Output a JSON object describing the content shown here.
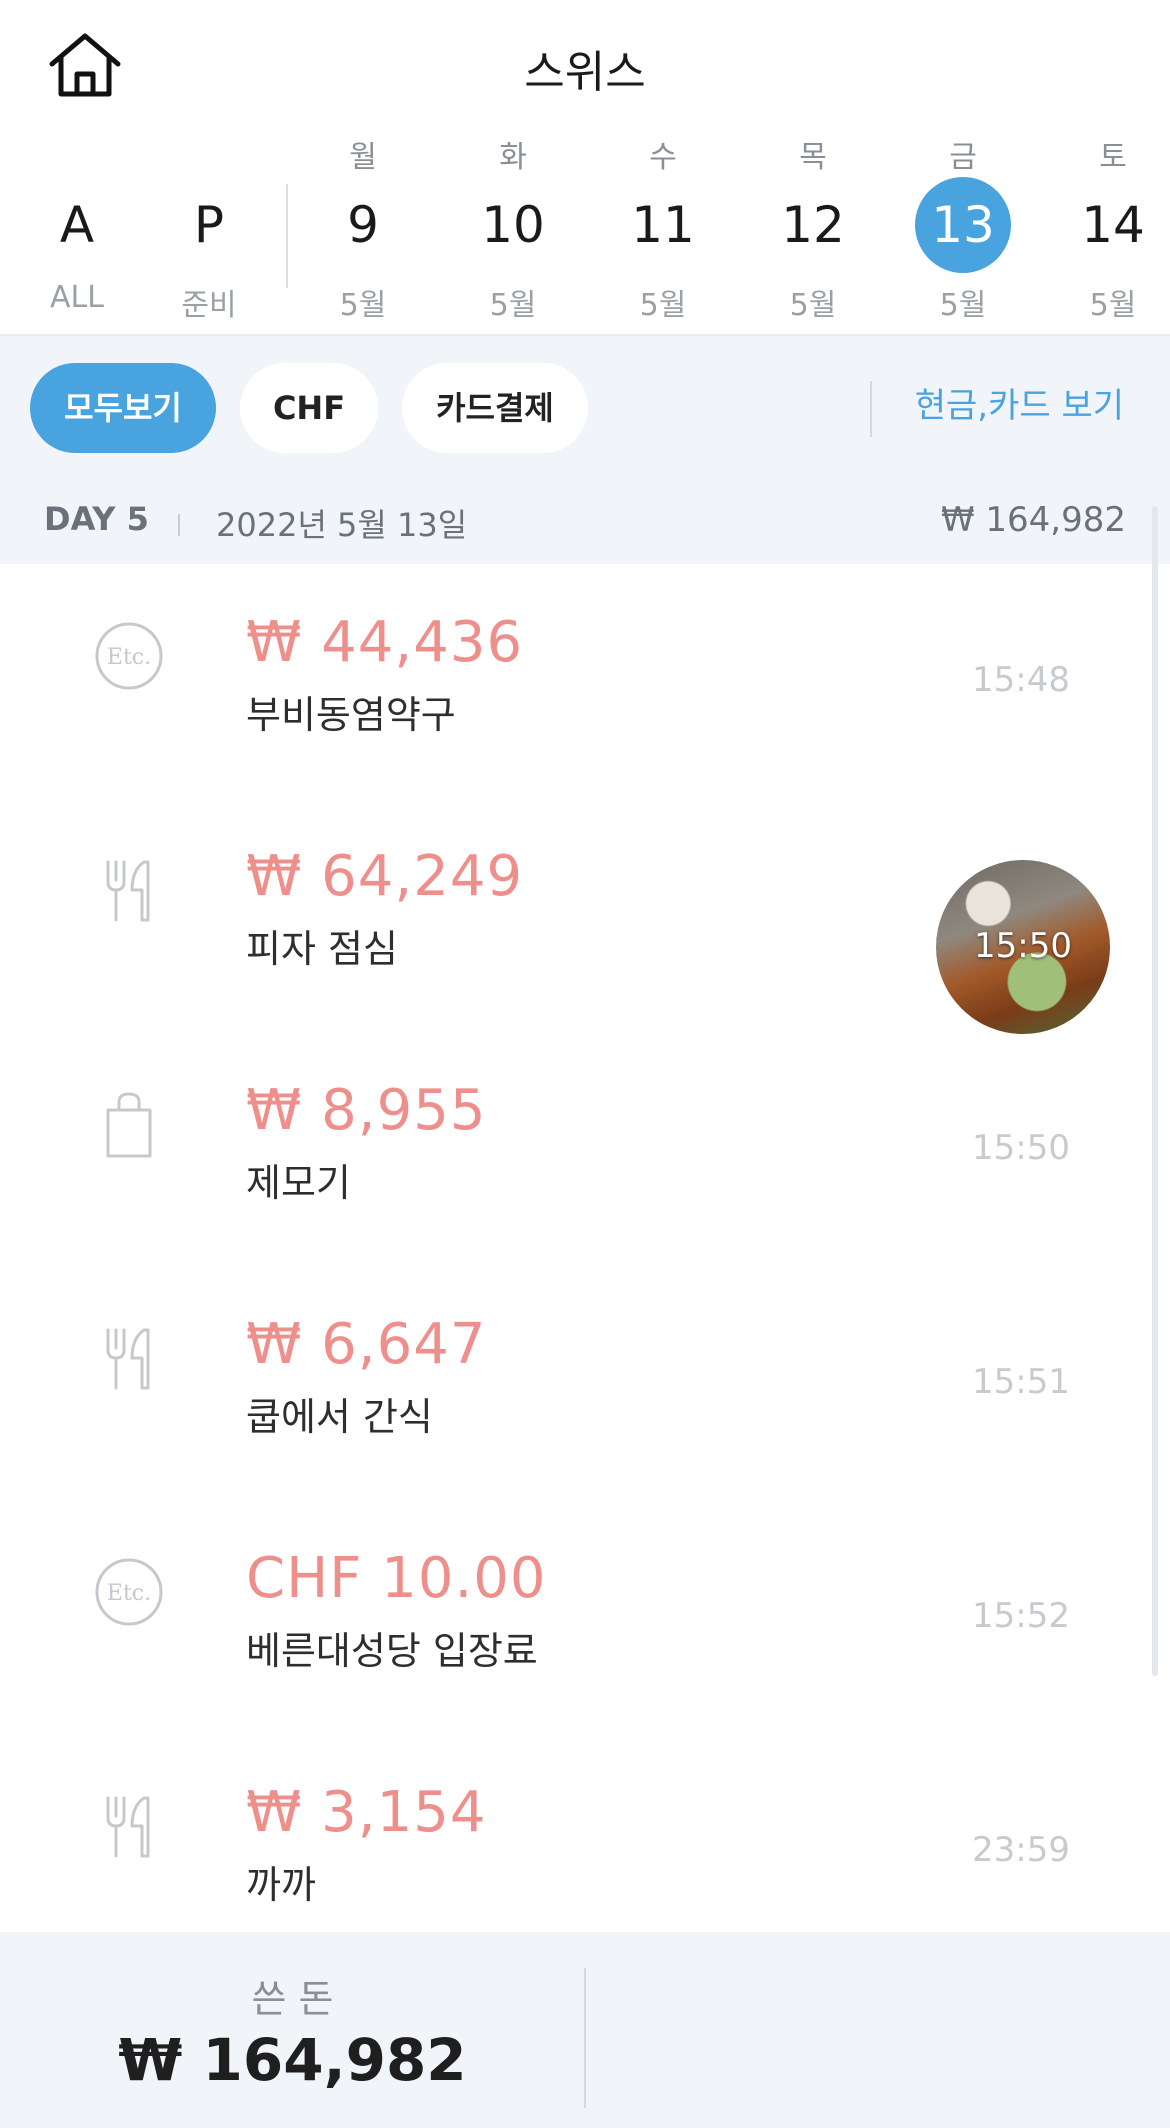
{
  "header": {
    "title": "스위스",
    "home_icon": "home-icon"
  },
  "plan_tabs": [
    {
      "letter": "A",
      "sub": "ALL"
    },
    {
      "letter": "P",
      "sub": "준비"
    }
  ],
  "days": [
    {
      "weekday": "월",
      "day": "9",
      "month": "5월",
      "selected": false
    },
    {
      "weekday": "화",
      "day": "10",
      "month": "5월",
      "selected": false
    },
    {
      "weekday": "수",
      "day": "11",
      "month": "5월",
      "selected": false
    },
    {
      "weekday": "목",
      "day": "12",
      "month": "5월",
      "selected": false
    },
    {
      "weekday": "금",
      "day": "13",
      "month": "5월",
      "selected": true
    },
    {
      "weekday": "토",
      "day": "14",
      "month": "5월",
      "selected": false
    }
  ],
  "filters": {
    "chips": [
      "모두보기",
      "CHF",
      "카드결제"
    ],
    "active": 0,
    "cash_card_link": "현금,카드 보기"
  },
  "day_summary": {
    "label": "DAY 5",
    "date": "2022년 5월 13일",
    "total": "₩ 164,982"
  },
  "transactions": [
    {
      "icon": "etc-icon",
      "amount": "₩ 44,436",
      "name": "부비동염약구",
      "time": "15:48",
      "has_photo": false
    },
    {
      "icon": "fork-knife-icon",
      "amount": "₩ 64,249",
      "name": "피자 점심",
      "time": "15:50",
      "has_photo": true
    },
    {
      "icon": "shopping-bag-icon",
      "amount": "₩ 8,955",
      "name": "제모기",
      "time": "15:50",
      "has_photo": false
    },
    {
      "icon": "fork-knife-icon",
      "amount": "₩ 6,647",
      "name": "쿱에서 간식",
      "time": "15:51",
      "has_photo": false
    },
    {
      "icon": "etc-icon",
      "amount": "CHF 10.00",
      "name": "베른대성당 입장료",
      "time": "15:52",
      "has_photo": false
    },
    {
      "icon": "fork-knife-icon",
      "amount": "₩ 3,154",
      "name": "까까",
      "time": "23:59",
      "has_photo": false
    }
  ],
  "footer": {
    "spent_label": "쓴 돈",
    "spent_value": "₩ 164,982"
  },
  "colors": {
    "accent": "#48a3df",
    "amount": "#ee8f8c",
    "panel_bg": "#f1f5fa"
  }
}
